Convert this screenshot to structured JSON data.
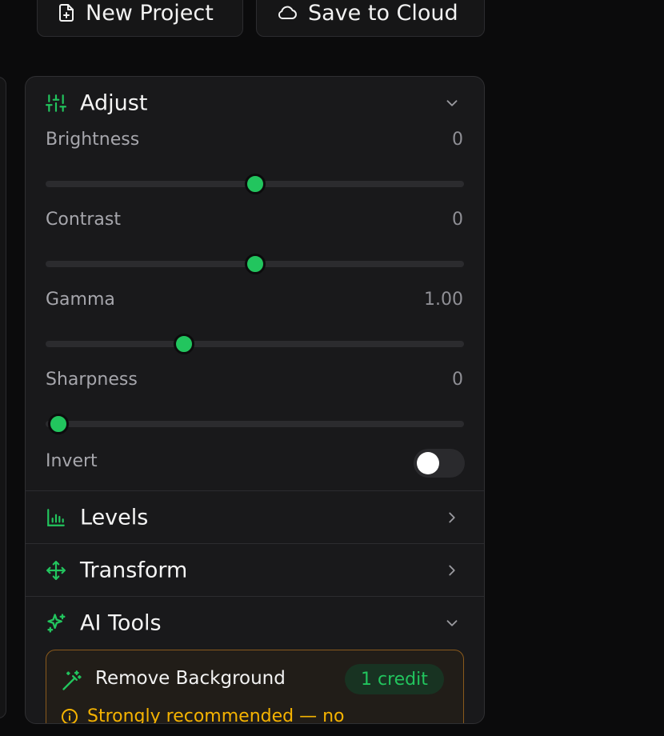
{
  "toolbar": {
    "new_project_label": "New Project",
    "save_cloud_label": "Save to Cloud"
  },
  "adjust": {
    "title": "Adjust",
    "expanded": true,
    "controls": [
      {
        "label": "Brightness",
        "value": "0",
        "fraction": 0.5
      },
      {
        "label": "Contrast",
        "value": "0",
        "fraction": 0.5
      },
      {
        "label": "Gamma",
        "value": "1.00",
        "fraction": 0.32
      },
      {
        "label": "Sharpness",
        "value": "0",
        "fraction": 0.0
      }
    ],
    "invert": {
      "label": "Invert",
      "on": false
    }
  },
  "levels": {
    "title": "Levels",
    "expanded": false
  },
  "transform": {
    "title": "Transform",
    "expanded": false
  },
  "ai_tools": {
    "title": "AI Tools",
    "expanded": true,
    "remove_background": {
      "label": "Remove Background",
      "credit": "1 credit",
      "warning": "Strongly recommended — no"
    }
  },
  "colors": {
    "accent": "#22c55e",
    "warning": "#f5b301",
    "panel_bg": "#19191b",
    "page_bg": "#0b0b0c"
  },
  "icons": {
    "new_project": "file-plus-icon",
    "save_cloud": "cloud-icon",
    "adjust": "sliders-icon",
    "levels": "bar-chart-icon",
    "transform": "move-icon",
    "ai_tools": "sparkles-icon",
    "remove_background": "magic-wand-icon",
    "warning": "info-circle-icon"
  }
}
